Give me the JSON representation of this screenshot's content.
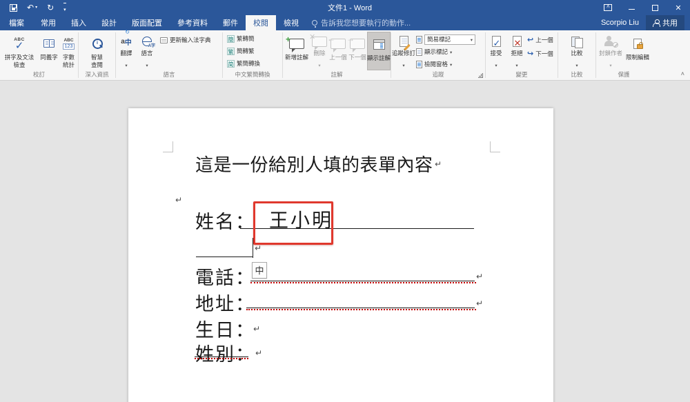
{
  "titlebar": {
    "title": "文件1 - Word"
  },
  "tabs": {
    "file": "檔案",
    "items": [
      "常用",
      "插入",
      "設計",
      "版面配置",
      "參考資料",
      "郵件",
      "校閱",
      "檢視"
    ],
    "tell_me": "告訴我您想要執行的動作...",
    "user": "Scorpio Liu",
    "share": "共用"
  },
  "ribbon": {
    "proofing": {
      "spelling_l1": "拼字及文法",
      "spelling_l2": "檢查",
      "thesaurus": "同義字",
      "wordcount_l1": "字數",
      "wordcount_l2": "統計",
      "group": "校訂"
    },
    "insights": {
      "smart_l1": "智慧",
      "smart_l2": "查閱",
      "group": "深入資訊"
    },
    "language": {
      "translate": "翻譯",
      "language": "語言",
      "update_ime": "更新輸入法字典",
      "group": "語言"
    },
    "chinese": {
      "tc_to_sc": "繁轉簡",
      "sc_to_tc": "簡轉繁",
      "convert": "繁簡轉換",
      "icon_tc_sc": "簡",
      "icon_sc_tc": "繁",
      "icon_convert": "简",
      "group": "中文繁簡轉換"
    },
    "comments": {
      "new": "新增註解",
      "delete": "刪除",
      "prev": "上一個",
      "next": "下一個",
      "show": "顯示註解",
      "group": "註解"
    },
    "tracking": {
      "track": "追蹤修訂",
      "simple_markup": "簡易標記",
      "show_markup": "顯示標記",
      "reviewing_pane": "檢閱窗格",
      "group": "追蹤"
    },
    "changes": {
      "accept": "接受",
      "reject": "拒絕",
      "prev": "上一個",
      "next": "下一個",
      "group": "變更"
    },
    "compare": {
      "compare": "比較",
      "group": "比較"
    },
    "protect": {
      "block_authors": "封鎖作者",
      "restrict_editing": "限制編輯",
      "group": "保護"
    }
  },
  "document": {
    "heading": "這是一份給別人填的表單內容",
    "name_label": "姓名：",
    "name_value": "王小明",
    "phone_label": "電話：",
    "address_label": "地址：",
    "birthday_label": "生日：",
    "gender_label": "姓別：",
    "ime_mode": "中",
    "paragraph_mark": "↵"
  },
  "colors": {
    "accent": "#2b579a",
    "annotation_red": "#e0382d",
    "squiggle_red": "#c00000"
  }
}
